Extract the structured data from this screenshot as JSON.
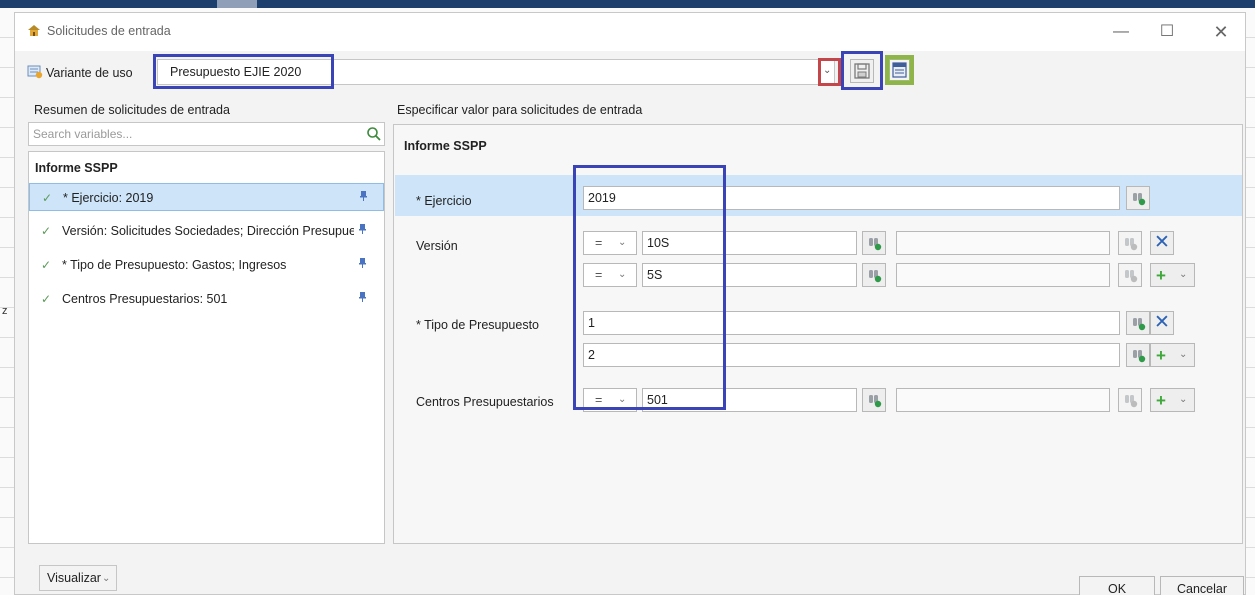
{
  "dialog": {
    "title": "Solicitudes de entrada"
  },
  "variant": {
    "label": "Variante de uso",
    "value": "Presupuesto EJIE 2020"
  },
  "left_panel": {
    "title": "Resumen de solicitudes de entrada",
    "search_placeholder": "Search variables...",
    "group": "Informe SSPP",
    "items": [
      {
        "label": "* Ejercicio: 2019",
        "selected": true
      },
      {
        "label": "Versión: Solicitudes Sociedades; Dirección Presupuestos",
        "selected": false
      },
      {
        "label": "* Tipo de Presupuesto: Gastos; Ingresos",
        "selected": false
      },
      {
        "label": "Centros Presupuestarios: 501",
        "selected": false
      }
    ]
  },
  "right_panel": {
    "title": "Especificar valor para solicitudes de entrada",
    "header": "Informe SSPP",
    "operator": "=",
    "rows": {
      "ejercicio": {
        "label": "* Ejercicio",
        "value": "2019"
      },
      "version": {
        "label": "Versión",
        "values": [
          "10S",
          "5S"
        ]
      },
      "tipo": {
        "label": "* Tipo de Presupuesto",
        "values": [
          "1",
          "2"
        ]
      },
      "centros": {
        "label": "Centros Presupuestarios",
        "value": "501"
      }
    }
  },
  "footer": {
    "visualizar": "Visualizar",
    "ok": "OK",
    "cancel": "Cancelar"
  },
  "colors": {
    "highlight_blue": "#3a44b6",
    "highlight_red": "#c3464a",
    "highlight_green": "#8fb54a",
    "selection": "#cde4f9"
  },
  "icons": {
    "title": "app-icon",
    "variant": "variant-icon",
    "search": "search-icon",
    "save": "save-icon",
    "calculator": "calculator-icon",
    "help": "value-help-icon",
    "delete": "close-icon",
    "add": "plus-icon",
    "pin": "pin-icon"
  }
}
